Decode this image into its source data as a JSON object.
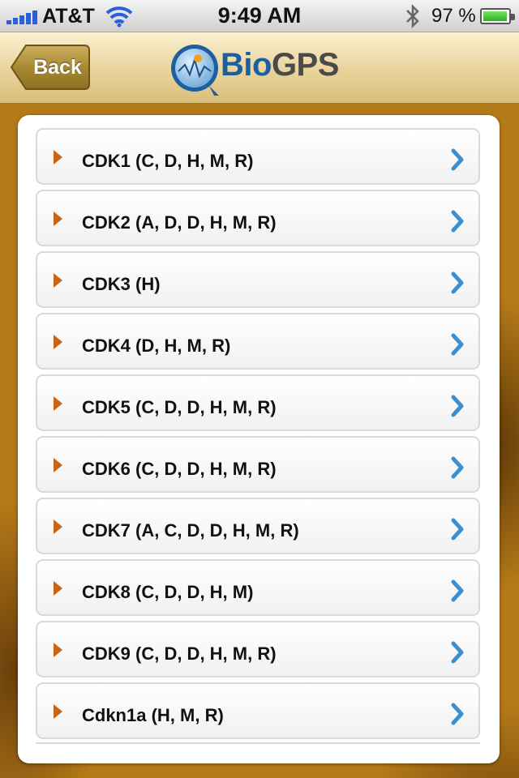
{
  "status_bar": {
    "carrier": "AT&T",
    "time": "9:49 AM",
    "battery_percent": "97 %",
    "battery_level": 0.97,
    "icons": [
      "signal-bars-icon",
      "wifi-icon",
      "bluetooth-icon",
      "battery-icon"
    ]
  },
  "nav": {
    "back_label": "Back",
    "logo_text_bio": "Bio",
    "logo_text_gps": "GPS"
  },
  "genes": [
    {
      "label": "CDK1 (C, D, H, M, R)"
    },
    {
      "label": "CDK2 (A, D, D, H, M, R)"
    },
    {
      "label": "CDK3 (H)"
    },
    {
      "label": "CDK4 (D, H, M, R)"
    },
    {
      "label": "CDK5 (C, D, D, H, M, R)"
    },
    {
      "label": "CDK6 (C, D, D, H, M, R)"
    },
    {
      "label": "CDK7 (A, C, D, D, H, M, R)"
    },
    {
      "label": "CDK8 (C, D, D, H, M)"
    },
    {
      "label": "CDK9 (C, D, D, H, M, R)"
    },
    {
      "label": "Cdkn1a (H, M, R)"
    }
  ],
  "colors": {
    "accent_arrow": "#c96414",
    "chevron": "#3a8fd0",
    "nav_bg": "#e8d39a",
    "back_button": "#a98930"
  }
}
